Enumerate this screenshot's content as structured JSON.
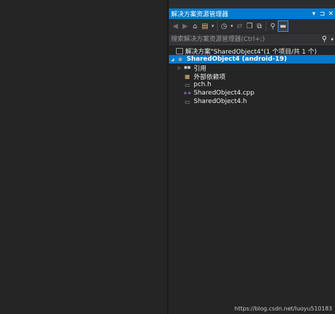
{
  "panel": {
    "title": "解决方案资源管理器",
    "title_buttons": [
      "▾",
      "⊐",
      "✕"
    ]
  },
  "toolbar": {
    "back_icon": "◀",
    "forward_icon": "▶",
    "home_icon": "⌂",
    "switch_views_icon": "▤",
    "switch_views_dropdown": "▾",
    "pending_changes_icon": "◷",
    "pending_dropdown": "▾",
    "sync_icon": "⇄",
    "collapse_all_icon": "❐",
    "show_all_files_icon": "⧉",
    "properties_icon": "⚲",
    "preview_icon": "▬"
  },
  "search": {
    "placeholder": "搜索解决方案资源管理器(Ctrl+;)",
    "icon": "⚲",
    "dropdown": "▾"
  },
  "tree": {
    "solution": {
      "label": "解决方案\"SharedObject4\"(1 个项目/共 1 个)"
    },
    "project": {
      "label": "SharedObject4 (android-19)",
      "expander": "◢"
    },
    "items": [
      {
        "label": "引用",
        "icon": "■■",
        "expander": "▷"
      },
      {
        "label": "外部依赖项",
        "icon": "▦"
      },
      {
        "label": "pch.h",
        "icon": "▭"
      },
      {
        "label": "SharedObject4.cpp",
        "icon": "++"
      },
      {
        "label": "SharedObject4.h",
        "icon": "▭"
      }
    ]
  },
  "watermark": "https://blog.csdn.net/luoyu510183",
  "colors": {
    "accent": "#007acc",
    "background": "#252526",
    "toolbar": "#2d2d30"
  }
}
